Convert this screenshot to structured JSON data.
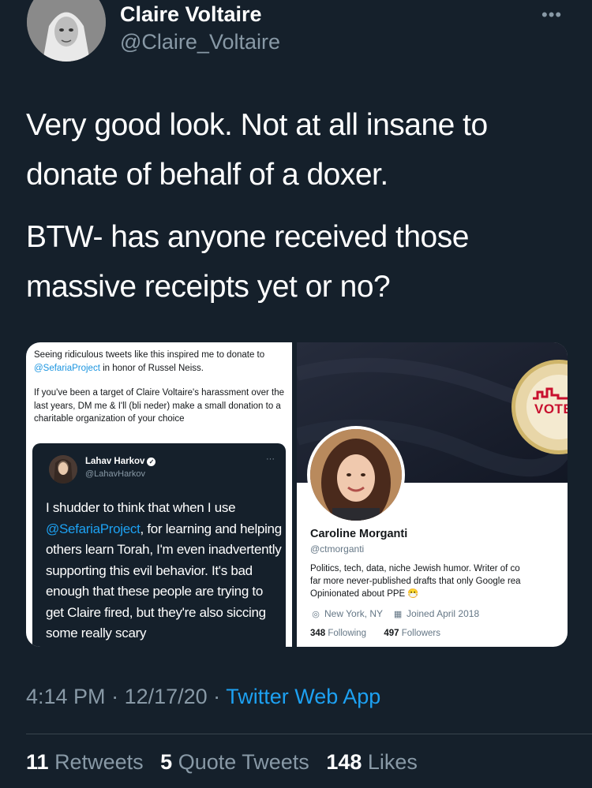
{
  "author": {
    "name": "Claire Voltaire",
    "handle": "@Claire_Voltaire"
  },
  "tweet": {
    "text_1": "Very good look. Not at all insane to donate of behalf of a doxer.",
    "text_2": "BTW- has anyone received those massive receipts yet or no?"
  },
  "quoted": {
    "line1_pre": "Seeing ridiculous tweets like this inspired me to donate to ",
    "line1_link": "@SefariaProject",
    "line1_post": " in honor of Russel Neiss.",
    "line2": "If you've been a target of Claire Voltaire's harassment over the last years, DM me & I'll (bli neder) make a small donation to a charitable organization of your choice",
    "embed": {
      "name": "Lahav Harkov",
      "handle": "@LahavHarkov",
      "more": "···",
      "body_pre": "I shudder to think that when I use ",
      "body_link": "@SefariaProject",
      "body_post": ", for learning and helping others learn Torah, I'm even inadvertently supporting this evil behavior. It's bad enough that these people are trying to get Claire fired, but they're also siccing some really scary"
    }
  },
  "profile_card": {
    "badge_text": "VOTE",
    "name": "Caroline Morganti",
    "handle": "@ctmorganti",
    "bio_1": "Politics, tech, data, niche Jewish humor. Writer of co",
    "bio_2": "far more never-published drafts that only Google rea",
    "bio_3": "Opinionated about PPE",
    "location": "New York, NY",
    "joined": "Joined April 2018",
    "following_count": "348",
    "following_label": "Following",
    "followers_count": "497",
    "followers_label": "Followers"
  },
  "meta": {
    "time": "4:14 PM",
    "date": "12/17/20",
    "app": "Twitter Web App"
  },
  "stats": {
    "retweets_count": "11",
    "retweets_label": "Retweets",
    "quotes_count": "5",
    "quotes_label": "Quote Tweets",
    "likes_count": "148",
    "likes_label": "Likes"
  },
  "icons": {
    "more": "more-icon",
    "verified": "verified-icon",
    "location": "location-icon",
    "calendar": "calendar-icon",
    "emoji": "mask-emoji-icon"
  },
  "colors": {
    "background": "#15202b",
    "link": "#1da1f2",
    "muted": "#8899a6"
  }
}
